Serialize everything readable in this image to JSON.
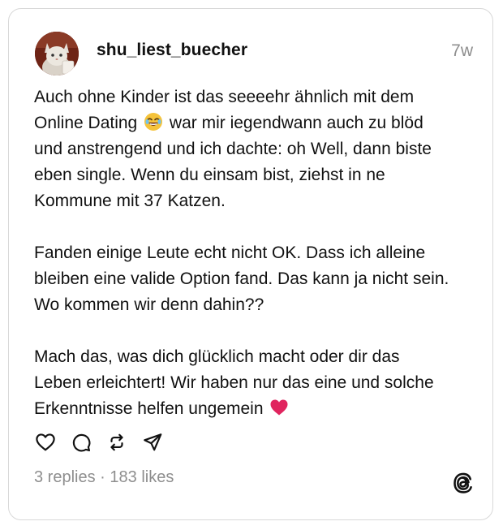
{
  "post": {
    "username": "shu_liest_buecher",
    "timestamp": "7w",
    "avatar_icon": "cat-avatar",
    "paragraphs": [
      {
        "lines": [
          "Auch ohne Kinder ist das seeeehr ähnlich mit dem",
          [
            "Online Dating ",
            "😂",
            " war mir iegendwann auch zu blöd"
          ],
          "und anstrengend und ich dachte: oh Well, dann biste",
          "eben single. Wenn du einsam bist, ziehst in ne",
          "Kommune mit 37 Katzen."
        ]
      },
      {
        "lines": [
          "Fanden einige Leute echt nicht OK. Dass ich alleine",
          "bleiben eine valide Option fand. Das kann ja nicht sein.",
          "Wo kommen wir denn dahin??"
        ]
      },
      {
        "lines": [
          "Mach das, was dich glücklich macht oder dir das",
          "Leben erleichtert! Wir haben nur das eine und solche",
          [
            "Erkenntnisse helfen ungemein ",
            "❤️",
            ""
          ]
        ]
      }
    ],
    "stats": {
      "replies": "3 replies",
      "separator": " · ",
      "likes": "183 likes"
    },
    "actions": [
      "heart-icon",
      "reply-icon",
      "repost-icon",
      "share-icon"
    ],
    "brand_icon": "threads-logo-icon"
  },
  "colors": {
    "text": "#111111",
    "muted": "#8e8e8e",
    "border": "#d8d8d8",
    "heart_emoji": "#e0245e",
    "laugh_emoji": "#f5c33b"
  }
}
